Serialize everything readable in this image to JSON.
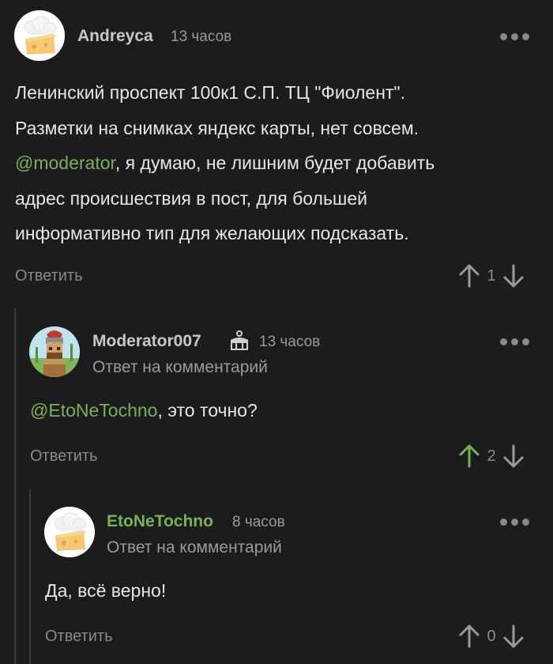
{
  "comments": [
    {
      "author": "Andreyca",
      "time": "13 часов",
      "body_lines": [
        "Ленинский проспект 100к1 С.П. ТЦ \"Фиолент\".",
        "Разметки на снимках яндекс карты, нет совсем."
      ],
      "mention": "@moderator",
      "body_after_mention": ", я думаю, не лишним будет добавить",
      "body_lines_tail": [
        "адрес происшествия в пост, для большей",
        "информативно тип для желающих подсказать."
      ],
      "reply_label": "Ответить",
      "votes": "1",
      "avatar_icon": "chef-hat-cheese-avatar",
      "author_color": "#c8c8c8"
    },
    {
      "author": "Moderator007",
      "time": "13 часов",
      "subtitle": "Ответ на комментарий",
      "mention": "@EtoNeTochno",
      "body_after_mention": ", это точно?",
      "reply_label": "Ответить",
      "votes": "2",
      "upvoted": true,
      "avatar_icon": "gladiator-avatar",
      "badge_icon": "cake-icon",
      "author_color": "#c8c8c8"
    },
    {
      "author": "EtoNeTochno",
      "time": "8 часов",
      "subtitle": "Ответ на комментарий",
      "body": "Да, всё верно!",
      "reply_label": "Ответить",
      "votes": "0",
      "avatar_icon": "chef-hat-cheese-avatar",
      "author_color": "#77b255"
    }
  ],
  "colors": {
    "background": "#1c1c1e",
    "accent_green": "#77b255",
    "muted": "#8a8a8a",
    "thread_line": "#3a3a3c"
  }
}
